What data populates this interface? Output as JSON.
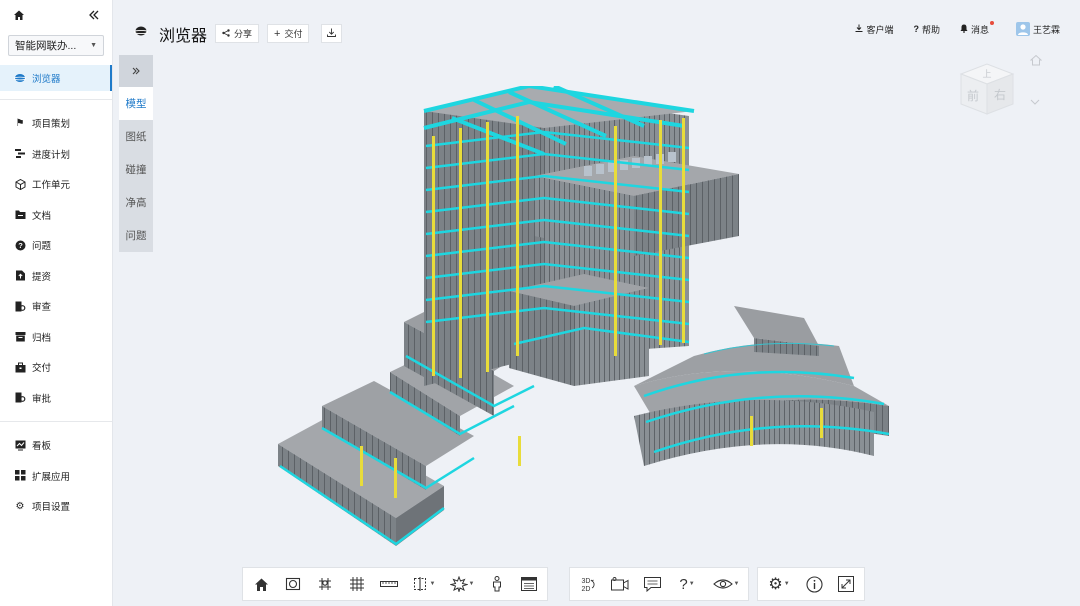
{
  "sidebar": {
    "project": "智能网联办...",
    "active": "浏览器",
    "group1": [
      "项目策划",
      "进度计划",
      "工作单元",
      "文档",
      "问题",
      "提资",
      "审查",
      "归档",
      "交付",
      "审批"
    ],
    "group2": [
      "看板",
      "扩展应用",
      "项目设置"
    ]
  },
  "header": {
    "title": "浏览器",
    "share_label": "分享",
    "deliver_label": "交付",
    "client_label": "客户端",
    "help_label": "帮助",
    "messages_label": "消息",
    "user_name": "王艺霖"
  },
  "tabs": [
    "模型",
    "图纸",
    "碰撞",
    "净高",
    "问题"
  ],
  "viewcube": {
    "front": "前",
    "right": "右",
    "top": "上"
  },
  "toolbar_icons": {
    "group1": [
      "home-view",
      "section-box",
      "locate",
      "grid",
      "measure",
      "section",
      "explode",
      "person",
      "properties"
    ],
    "group2": [
      "3d-2d",
      "camera",
      "comment",
      "help",
      "visibility"
    ],
    "group3": [
      "settings",
      "info",
      "fullscreen"
    ],
    "labels": {
      "3d2d_top": "3D",
      "3d2d_bottom": "2D"
    }
  }
}
